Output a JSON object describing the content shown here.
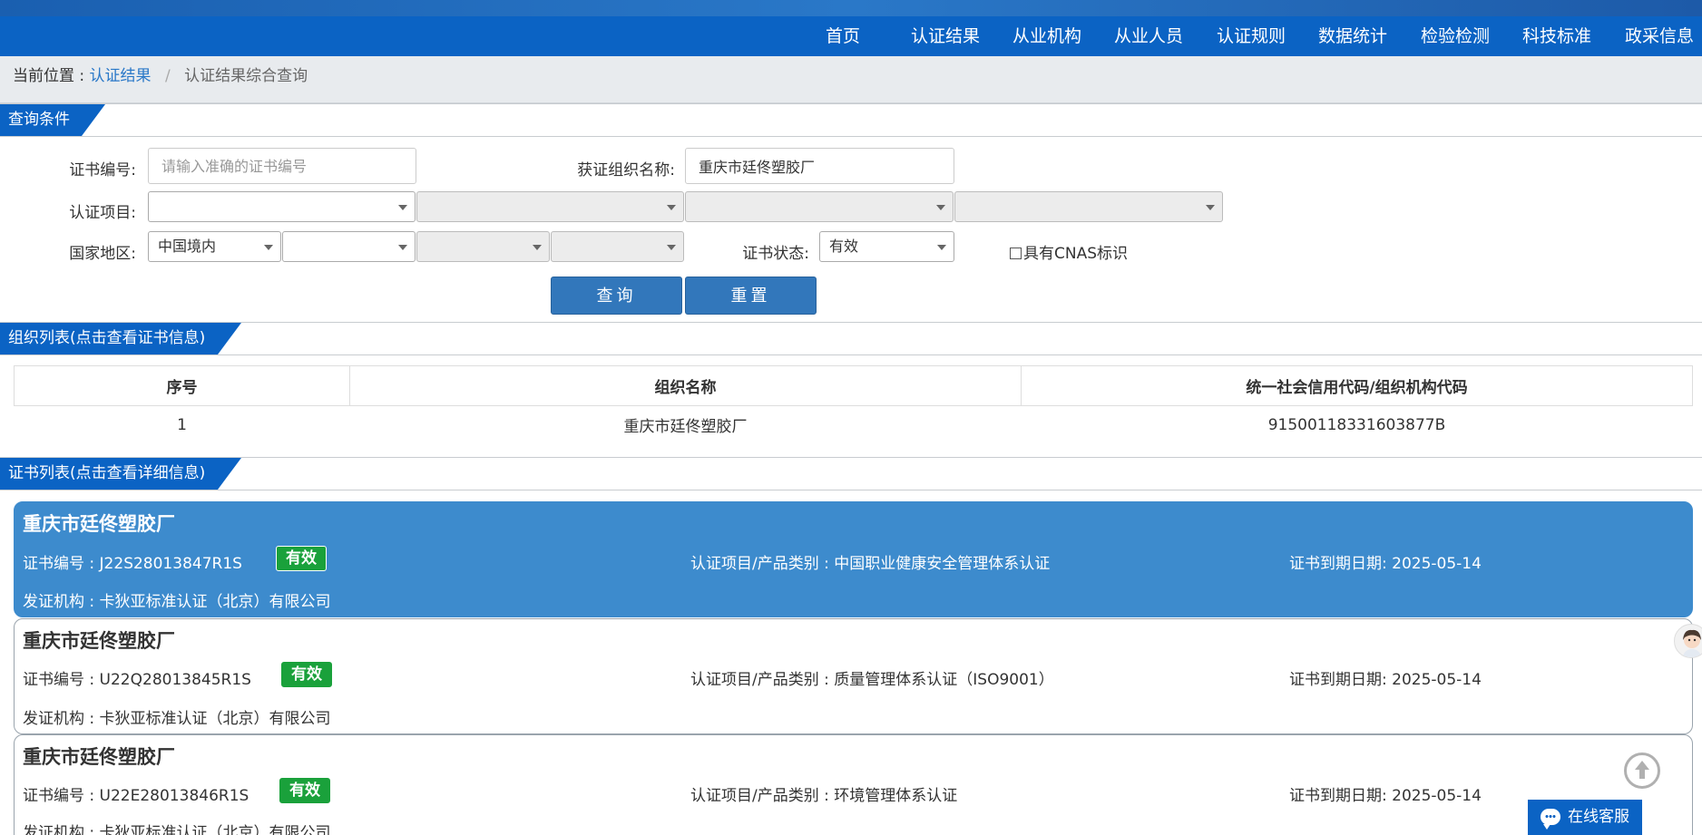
{
  "nav": {
    "items": [
      "首页",
      "认证结果",
      "从业机构",
      "从业人员",
      "认证规则",
      "数据统计",
      "检验检测",
      "科技标准",
      "政采信息"
    ]
  },
  "breadcrumb": {
    "prefix": "当前位置 :",
    "link": "认证结果",
    "current": "认证结果综合查询"
  },
  "query": {
    "section_title": "查询条件",
    "cert_no_label": "证书编号:",
    "cert_no_placeholder": "请输入准确的证书编号",
    "org_name_label": "获证组织名称:",
    "org_name_value": "重庆市廷佟塑胶厂",
    "cert_project_label": "认证项目:",
    "region_label": "国家地区:",
    "region_value": "中国境内",
    "status_label": "证书状态:",
    "status_value": "有效",
    "cnas_label": "具有CNAS标识",
    "search_button": "查询",
    "reset_button": "重置"
  },
  "org_list": {
    "section_title": "组织列表(点击查看证书信息)",
    "headers": [
      "序号",
      "组织名称",
      "统一社会信用代码/组织机构代码"
    ],
    "rows": [
      {
        "index": "1",
        "name": "重庆市廷佟塑胶厂",
        "code": "91500118331603877B"
      }
    ]
  },
  "cert_list": {
    "section_title": "证书列表(点击查看详细信息)",
    "cert_no_prefix": "证书编号 :",
    "project_prefix": "认证项目/产品类别 :",
    "expiry_prefix": "证书到期日期:",
    "issuer_prefix": "发证机构 :",
    "items": [
      {
        "org": "重庆市廷佟塑胶厂",
        "cert_no": "J22S28013847R1S",
        "status": "有效",
        "project": "中国职业健康安全管理体系认证",
        "expiry": "2025-05-14",
        "issuer": "卡狄亚标准认证（北京）有限公司"
      },
      {
        "org": "重庆市廷佟塑胶厂",
        "cert_no": "U22Q28013845R1S",
        "status": "有效",
        "project": "质量管理体系认证（ISO9001）",
        "expiry": "2025-05-14",
        "issuer": "卡狄亚标准认证（北京）有限公司"
      },
      {
        "org": "重庆市廷佟塑胶厂",
        "cert_no": "U22E28013846R1S",
        "status": "有效",
        "project": "环境管理体系认证",
        "expiry": "2025-05-14",
        "issuer": "卡狄亚标准认证（北京）有限公司"
      }
    ]
  },
  "widgets": {
    "chat_label": "在线客服"
  }
}
